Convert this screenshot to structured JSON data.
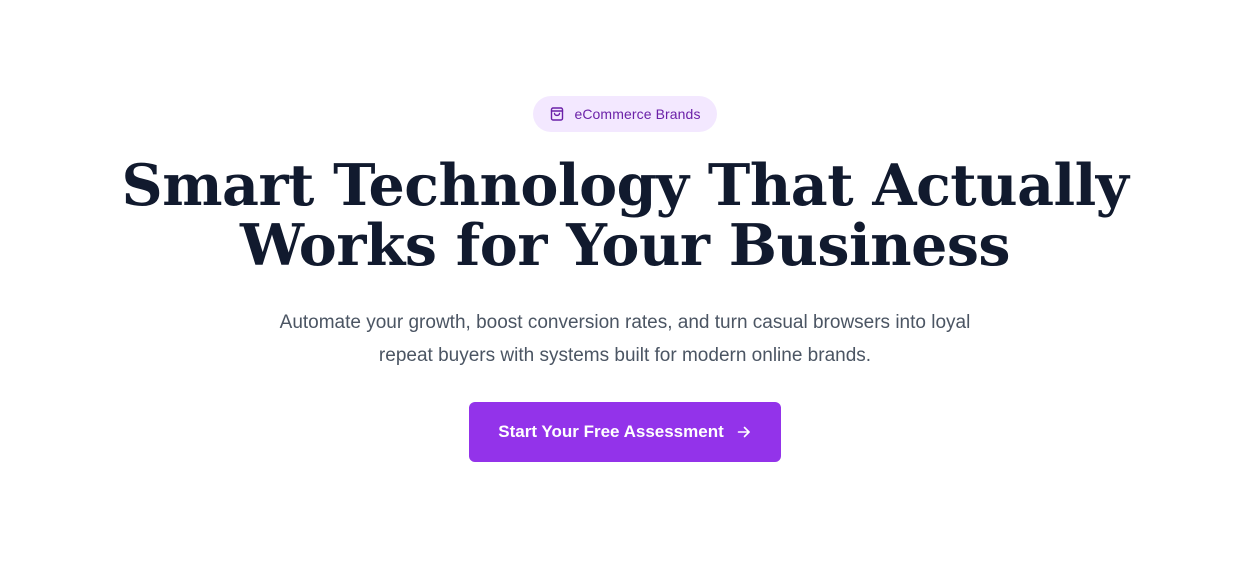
{
  "badge": {
    "icon": "shopping-bag-icon",
    "label": "eCommerce Brands"
  },
  "headline": {
    "line1": "Smart Technology That Actually",
    "line2": "Works for Your Business"
  },
  "subtitle": {
    "line1": "Automate your growth, boost conversion rates, and turn casual browsers into loyal",
    "line2": "repeat buyers with systems built for modern online brands."
  },
  "cta": {
    "label": "Start Your Free Assessment",
    "icon": "arrow-right-icon"
  },
  "colors": {
    "accent": "#9333ea",
    "badge_bg": "#f3e8ff",
    "badge_text": "#6b21a8",
    "heading": "#111a2e",
    "body_text": "#4b5563"
  }
}
